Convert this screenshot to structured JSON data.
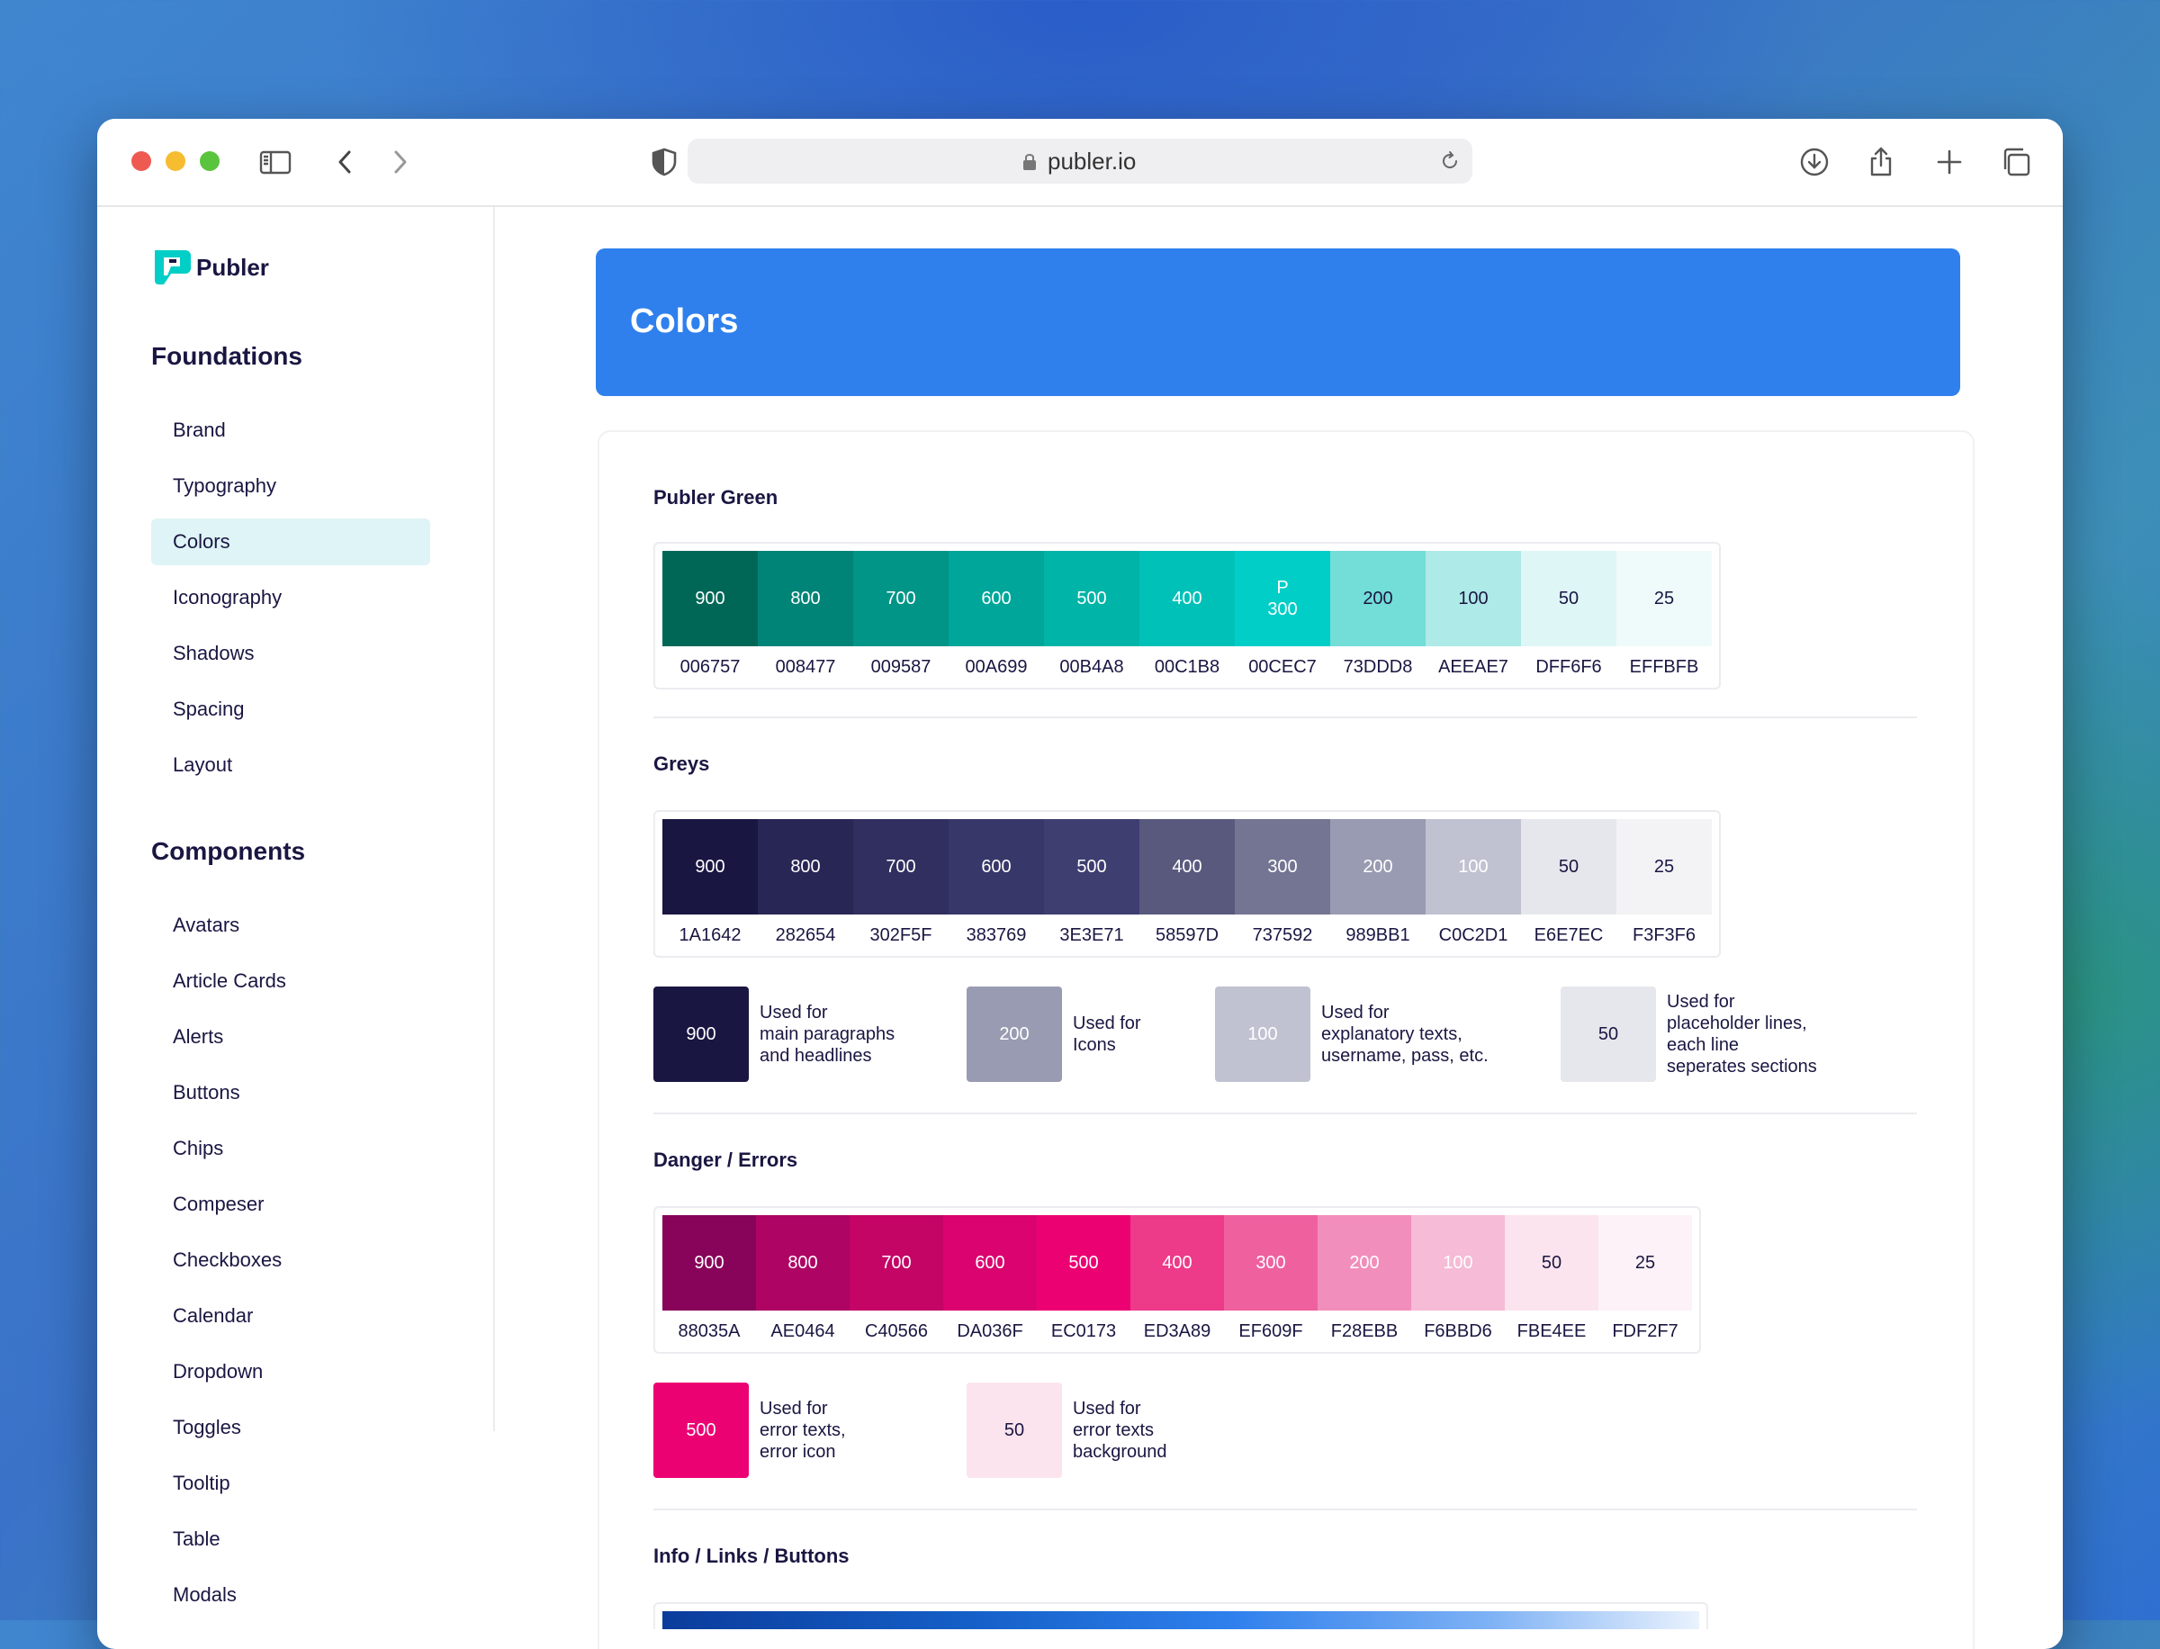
{
  "browser": {
    "url": "publer.io",
    "icons": [
      "sidebar-toggle-icon",
      "back-icon",
      "forward-icon",
      "shield-icon",
      "lock-icon",
      "reload-icon",
      "download-icon",
      "share-icon",
      "plus-icon",
      "tabs-icon"
    ]
  },
  "sidebar": {
    "brand": "Publer",
    "sections": [
      {
        "heading": "Foundations",
        "items": [
          "Brand",
          "Typography",
          "Colors",
          "Iconography",
          "Shadows",
          "Spacing",
          "Layout"
        ]
      },
      {
        "heading": "Components",
        "items": [
          "Avatars",
          "Article Cards",
          "Alerts",
          "Buttons",
          "Chips",
          "Compeser",
          "Checkboxes",
          "Calendar",
          "Dropdown",
          "Toggles",
          "Tooltip",
          "Table",
          "Modals"
        ]
      }
    ],
    "active_item": "Colors"
  },
  "page": {
    "title": "Colors"
  },
  "palettes": [
    {
      "title": "Publer Green",
      "swatches": [
        {
          "label": "900",
          "hex": "006757",
          "color": "#006757",
          "text_color": "#ffffff"
        },
        {
          "label": "800",
          "hex": "008477",
          "color": "#008477",
          "text_color": "#ffffff"
        },
        {
          "label": "700",
          "hex": "009587",
          "color": "#009587",
          "text_color": "#ffffff"
        },
        {
          "label": "600",
          "hex": "00A699",
          "color": "#00A699",
          "text_color": "#ffffff"
        },
        {
          "label": "500",
          "hex": "00B4A8",
          "color": "#00B4A8",
          "text_color": "#ffffff"
        },
        {
          "label": "400",
          "hex": "00C1B8",
          "color": "#00C1B8",
          "text_color": "#ffffff"
        },
        {
          "label": "P\n300",
          "hex": "00CEC7",
          "color": "#00CEC7",
          "text_color": "#ffffff"
        },
        {
          "label": "200",
          "hex": "73DDD8",
          "color": "#73DDD8",
          "text_color": "#1A1642"
        },
        {
          "label": "100",
          "hex": "AEEAE7",
          "color": "#AEEAE7",
          "text_color": "#1A1642"
        },
        {
          "label": "50",
          "hex": "DFF6F6",
          "color": "#DFF6F6",
          "text_color": "#1A1642"
        },
        {
          "label": "25",
          "hex": "EFFBFB",
          "color": "#EFFBFB",
          "text_color": "#1A1642"
        }
      ]
    },
    {
      "title": "Greys",
      "swatches": [
        {
          "label": "900",
          "hex": "1A1642",
          "color": "#1A1642",
          "text_color": "#ffffff"
        },
        {
          "label": "800",
          "hex": "282654",
          "color": "#282654",
          "text_color": "#ffffff"
        },
        {
          "label": "700",
          "hex": "302F5F",
          "color": "#302F5F",
          "text_color": "#ffffff"
        },
        {
          "label": "600",
          "hex": "383769",
          "color": "#383769",
          "text_color": "#ffffff"
        },
        {
          "label": "500",
          "hex": "3E3E71",
          "color": "#3E3E71",
          "text_color": "#ffffff"
        },
        {
          "label": "400",
          "hex": "58597D",
          "color": "#58597D",
          "text_color": "#ffffff"
        },
        {
          "label": "300",
          "hex": "737592",
          "color": "#737592",
          "text_color": "#ffffff"
        },
        {
          "label": "200",
          "hex": "989BB1",
          "color": "#989BB1",
          "text_color": "#ffffff"
        },
        {
          "label": "100",
          "hex": "C0C2D1",
          "color": "#C0C2D1",
          "text_color": "#ffffff"
        },
        {
          "label": "50",
          "hex": "E6E7EC",
          "color": "#E6E7EC",
          "text_color": "#1A1642"
        },
        {
          "label": "25",
          "hex": "F3F3F6",
          "color": "#F3F3F6",
          "text_color": "#1A1642"
        }
      ],
      "usages": [
        {
          "label": "900",
          "color": "#1A1642",
          "text_color": "#ffffff",
          "text": "Used for\nmain paragraphs\nand headlines"
        },
        {
          "label": "200",
          "color": "#989BB1",
          "text_color": "#ffffff",
          "text": "Used for\nIcons"
        },
        {
          "label": "100",
          "color": "#C0C2D1",
          "text_color": "#ffffff",
          "text": "Used for\nexplanatory texts,\nusername, pass, etc."
        },
        {
          "label": "50",
          "color": "#E6E7EC",
          "text_color": "#1A1642",
          "text": "Used for\nplaceholder lines,\neach line\nseperates sections"
        }
      ]
    },
    {
      "title": "Danger / Errors",
      "swatches": [
        {
          "label": "900",
          "hex": "88035A",
          "color": "#88035A",
          "text_color": "#ffffff"
        },
        {
          "label": "800",
          "hex": "AE0464",
          "color": "#AE0464",
          "text_color": "#ffffff"
        },
        {
          "label": "700",
          "hex": "C40566",
          "color": "#C40566",
          "text_color": "#ffffff"
        },
        {
          "label": "600",
          "hex": "DA036F",
          "color": "#DA036F",
          "text_color": "#ffffff"
        },
        {
          "label": "500",
          "hex": "EC0173",
          "color": "#EC0173",
          "text_color": "#ffffff"
        },
        {
          "label": "400",
          "hex": "ED3A89",
          "color": "#ED3A89",
          "text_color": "#ffffff"
        },
        {
          "label": "300",
          "hex": "EF609F",
          "color": "#EF609F",
          "text_color": "#ffffff"
        },
        {
          "label": "200",
          "hex": "F28EBB",
          "color": "#F28EBB",
          "text_color": "#ffffff"
        },
        {
          "label": "100",
          "hex": "F6BBD6",
          "color": "#F6BBD6",
          "text_color": "#ffffff"
        },
        {
          "label": "50",
          "hex": "FBE4EE",
          "color": "#FBE4EE",
          "text_color": "#1A1642"
        },
        {
          "label": "25",
          "hex": "FDF2F7",
          "color": "#FDF2F7",
          "text_color": "#1A1642"
        }
      ],
      "usages": [
        {
          "label": "500",
          "color": "#EC0173",
          "text_color": "#ffffff",
          "text": "Used for\nerror texts,\nerror icon"
        },
        {
          "label": "50",
          "color": "#FBE4EE",
          "text_color": "#1A1642",
          "text": "Used for\nerror texts\nbackground"
        }
      ]
    },
    {
      "title": "Info / Links / Buttons"
    }
  ]
}
